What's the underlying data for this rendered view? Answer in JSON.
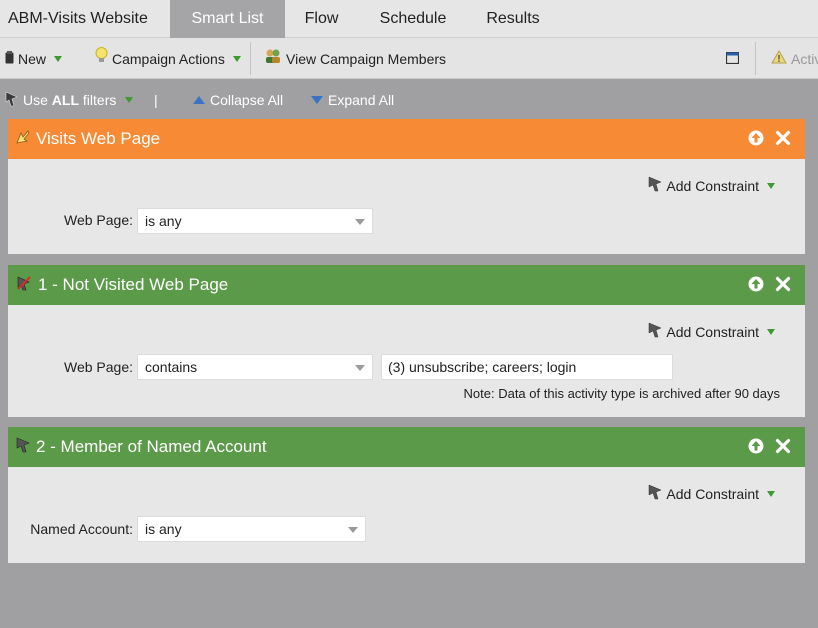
{
  "tabs": [
    {
      "label": "ABM-Visits Website",
      "active": false
    },
    {
      "label": "Smart List",
      "active": true
    },
    {
      "label": "Flow",
      "active": false
    },
    {
      "label": "Schedule",
      "active": false
    },
    {
      "label": "Results",
      "active": false
    }
  ],
  "toolbar": {
    "new_label": "New",
    "campaign_actions_label": "Campaign Actions",
    "view_members_label": "View Campaign Members",
    "activation_label": "Activ"
  },
  "filter_bar": {
    "use_all_prefix": "Use ",
    "use_all_bold": "ALL",
    "use_all_suffix": " filters",
    "separator": "|",
    "collapse_all": "Collapse All",
    "expand_all": "Expand All"
  },
  "filters": [
    {
      "title": "Visits Web Page",
      "add_constraint": "Add Constraint",
      "field_label": "Web Page:",
      "operator": "is any"
    },
    {
      "title": "1 - Not Visited Web Page",
      "add_constraint": "Add Constraint",
      "field_label": "Web Page:",
      "operator": "contains",
      "value": "(3) unsubscribe; careers; login",
      "note": "Note: Data of this activity type is archived after 90 days"
    },
    {
      "title": "2 - Member of Named Account",
      "add_constraint": "Add Constraint",
      "field_label": "Named Account:",
      "operator": "is any"
    }
  ],
  "colors": {
    "orange_header": "#f78a34",
    "green_header": "#5b9a48",
    "background": "#a0a0a3"
  }
}
